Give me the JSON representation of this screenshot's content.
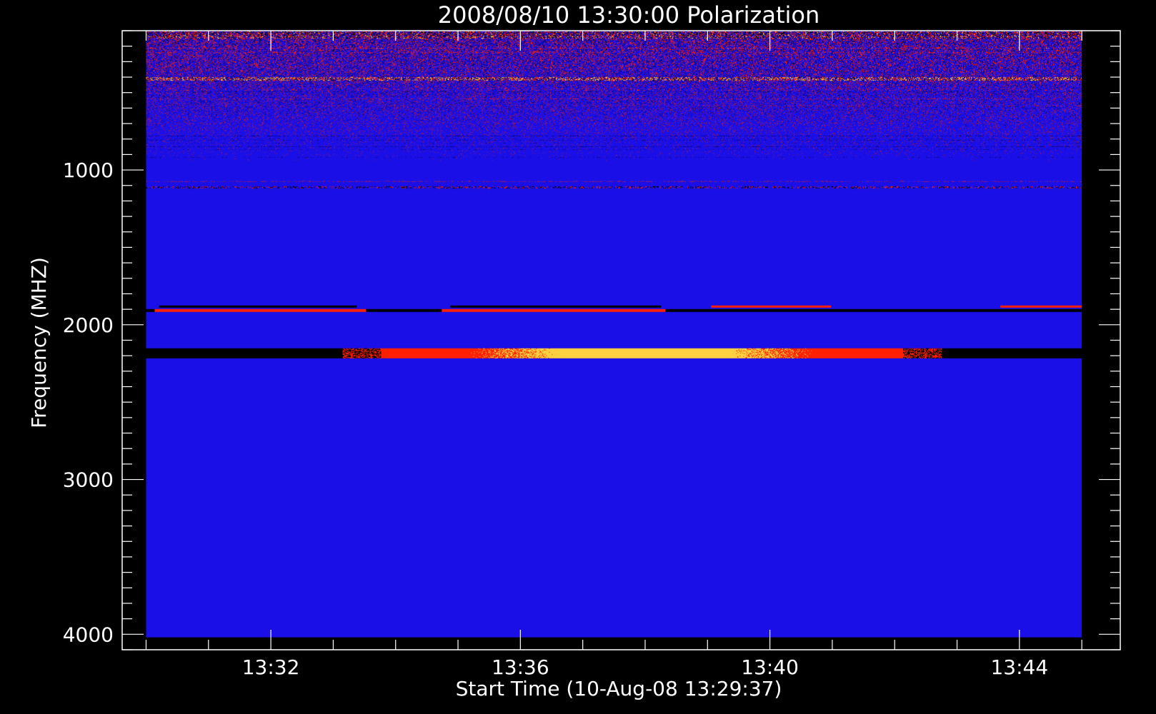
{
  "chart_data": {
    "type": "heatmap",
    "title": "2008/08/10 13:30:00 Polarization",
    "xlabel": "Start Time (10-Aug-08 13:29:37)",
    "ylabel": "Frequency (MHZ)",
    "x_range_minutes": [
      "13:29:37",
      "13:45:37"
    ],
    "x_data_extent": [
      "13:30:00",
      "13:45:00"
    ],
    "x_ticks": [
      "13:32",
      "13:36",
      "13:40",
      "13:44"
    ],
    "y_range": [
      100,
      4100
    ],
    "y_reversed": true,
    "y_data_extent": [
      100,
      4020
    ],
    "y_ticks": [
      1000,
      2000,
      3000,
      4000
    ],
    "colormap": {
      "background": "#1a0fe6",
      "negative": "#000000",
      "positive": "#ff2000",
      "strong": "#ffd040"
    },
    "features": [
      {
        "label": "RFI noisy band",
        "freq_range": [
          100,
          1200
        ],
        "time_range": [
          "13:30:00",
          "13:45:00"
        ]
      },
      {
        "label": "bright line",
        "freq": 410,
        "time_range": [
          "13:30:00",
          "13:45:00"
        ]
      },
      {
        "label": "dashed line",
        "freq": 1110,
        "time_range": [
          "13:30:00",
          "13:45:00"
        ]
      },
      {
        "label": "band",
        "freq": 1900,
        "time_range": [
          "13:30:00",
          "13:45:00"
        ]
      },
      {
        "label": "band",
        "freq": 2180,
        "time_range": [
          "13:30:00",
          "13:45:00"
        ],
        "peak_time": "13:38:00"
      }
    ]
  }
}
